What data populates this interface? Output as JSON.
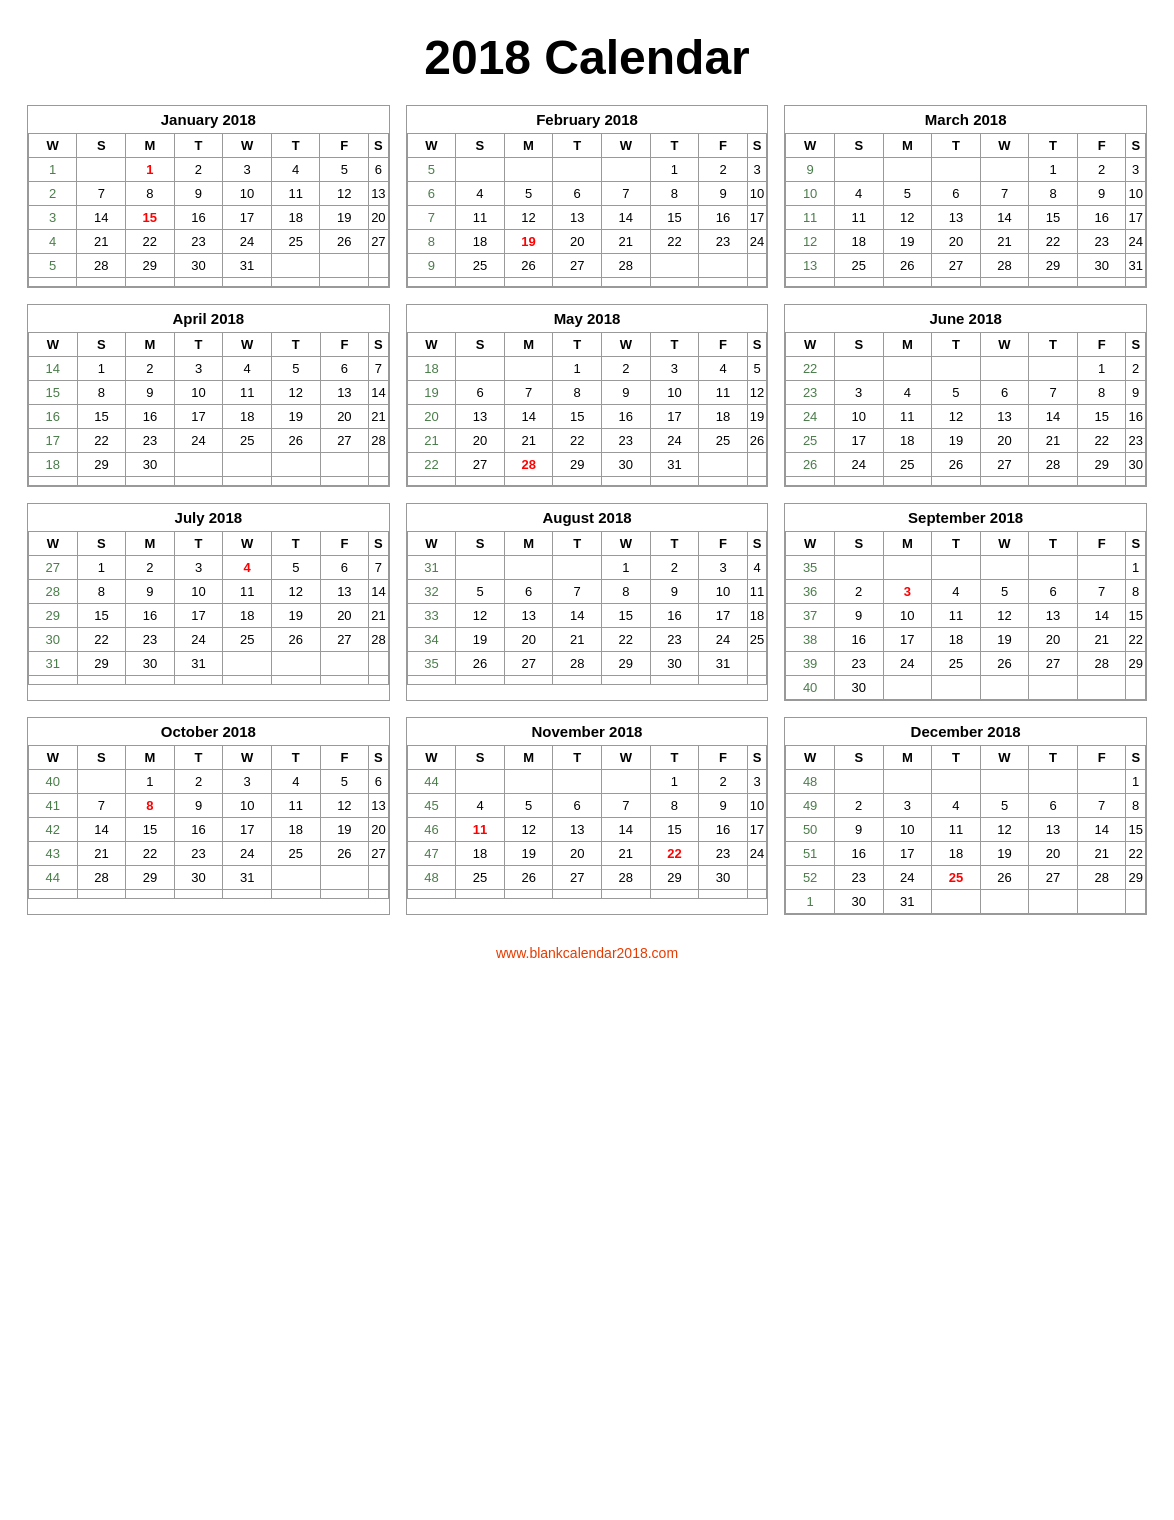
{
  "title": "2018 Calendar",
  "footer": "www.blankcalendar2018.com",
  "months": [
    {
      "name": "January 2018",
      "headers": [
        "W",
        "S",
        "M",
        "T",
        "W",
        "T",
        "F",
        "S"
      ],
      "rows": [
        [
          "1",
          "",
          "1",
          "2",
          "3",
          "4",
          "5",
          "6"
        ],
        [
          "2",
          "7",
          "8",
          "9",
          "10",
          "11",
          "12",
          "13"
        ],
        [
          "3",
          "14",
          "15",
          "16",
          "17",
          "18",
          "19",
          "20"
        ],
        [
          "4",
          "21",
          "22",
          "23",
          "24",
          "25",
          "26",
          "27"
        ],
        [
          "5",
          "28",
          "29",
          "30",
          "31",
          "",
          "",
          ""
        ]
      ],
      "redCells": [
        [
          "0",
          "2"
        ],
        [
          "1",
          "1"
        ]
      ],
      "greenCells": [
        [
          "2",
          "2"
        ]
      ]
    },
    {
      "name": "February 2018",
      "headers": [
        "W",
        "S",
        "M",
        "T",
        "W",
        "T",
        "F",
        "S"
      ],
      "rows": [
        [
          "5",
          "",
          "",
          "",
          "1",
          "2",
          "3"
        ],
        [
          "6",
          "4",
          "5",
          "6",
          "7",
          "8",
          "9",
          "10"
        ],
        [
          "7",
          "11",
          "12",
          "13",
          "14",
          "15",
          "16",
          "17"
        ],
        [
          "8",
          "18",
          "19",
          "20",
          "21",
          "22",
          "23",
          "24"
        ],
        [
          "9",
          "25",
          "26",
          "27",
          "28",
          "",
          "",
          ""
        ]
      ],
      "redCells": [
        [
          "1",
          "3"
        ],
        [
          "2",
          "3"
        ],
        [
          "0",
          "3"
        ],
        [
          "0",
          "4"
        ],
        [
          "0",
          "5"
        ]
      ],
      "greenCells": [
        [
          "1",
          "2"
        ]
      ]
    },
    {
      "name": "March 2018",
      "headers": [
        "W",
        "S",
        "M",
        "T",
        "W",
        "T",
        "F",
        "S"
      ],
      "rows": [
        [
          "9",
          "",
          "",
          "",
          "1",
          "2",
          "3"
        ],
        [
          "10",
          "4",
          "5",
          "6",
          "7",
          "8",
          "9",
          "10"
        ],
        [
          "11",
          "11",
          "12",
          "13",
          "14",
          "15",
          "16",
          "17"
        ],
        [
          "12",
          "18",
          "19",
          "20",
          "21",
          "22",
          "23",
          "24"
        ],
        [
          "13",
          "25",
          "26",
          "27",
          "28",
          "29",
          "30",
          "31"
        ]
      ],
      "redCells": [],
      "greenCells": []
    },
    {
      "name": "April 2018",
      "headers": [
        "W",
        "S",
        "M",
        "T",
        "W",
        "T",
        "F",
        "S"
      ],
      "rows": [
        [
          "14",
          "1",
          "2",
          "3",
          "4",
          "5",
          "6",
          "7"
        ],
        [
          "15",
          "8",
          "9",
          "10",
          "11",
          "12",
          "13",
          "14"
        ],
        [
          "16",
          "15",
          "16",
          "17",
          "18",
          "19",
          "20",
          "21"
        ],
        [
          "17",
          "22",
          "23",
          "24",
          "25",
          "26",
          "27",
          "28"
        ],
        [
          "18",
          "29",
          "30",
          "",
          "",
          "",
          "",
          ""
        ]
      ],
      "redCells": [],
      "greenCells": []
    },
    {
      "name": "May 2018",
      "headers": [
        "W",
        "S",
        "M",
        "T",
        "W",
        "T",
        "F",
        "S"
      ],
      "rows": [
        [
          "18",
          "",
          "1",
          "2",
          "3",
          "4",
          "5"
        ],
        [
          "19",
          "6",
          "7",
          "8",
          "9",
          "10",
          "11",
          "12"
        ],
        [
          "20",
          "13",
          "14",
          "15",
          "16",
          "17",
          "18",
          "19"
        ],
        [
          "21",
          "20",
          "21",
          "22",
          "23",
          "24",
          "25",
          "26"
        ],
        [
          "22",
          "27",
          "28",
          "29",
          "30",
          "31",
          "",
          ""
        ]
      ],
      "redCells": [
        [
          "4",
          "2"
        ]
      ],
      "greenCells": []
    },
    {
      "name": "June 2018",
      "headers": [
        "W",
        "S",
        "M",
        "T",
        "W",
        "T",
        "F",
        "S"
      ],
      "rows": [
        [
          "22",
          "",
          "",
          "",
          "",
          "",
          "1",
          "2"
        ],
        [
          "23",
          "3",
          "4",
          "5",
          "6",
          "7",
          "8",
          "9"
        ],
        [
          "24",
          "10",
          "11",
          "12",
          "13",
          "14",
          "15",
          "16"
        ],
        [
          "25",
          "17",
          "18",
          "19",
          "20",
          "21",
          "22",
          "23"
        ],
        [
          "26",
          "24",
          "25",
          "26",
          "27",
          "28",
          "29",
          "30"
        ]
      ],
      "redCells": [],
      "greenCells": []
    },
    {
      "name": "July 2018",
      "headers": [
        "W",
        "S",
        "M",
        "T",
        "W",
        "T",
        "F",
        "S"
      ],
      "rows": [
        [
          "27",
          "1",
          "2",
          "3",
          "4",
          "5",
          "6",
          "7"
        ],
        [
          "28",
          "8",
          "9",
          "10",
          "11",
          "12",
          "13",
          "14"
        ],
        [
          "29",
          "15",
          "16",
          "17",
          "18",
          "19",
          "20",
          "21"
        ],
        [
          "30",
          "22",
          "23",
          "24",
          "25",
          "26",
          "27",
          "28"
        ],
        [
          "31",
          "29",
          "30",
          "31",
          "",
          "",
          "",
          ""
        ]
      ],
      "redCells": [
        [
          "0",
          "4"
        ]
      ],
      "greenCells": []
    },
    {
      "name": "August 2018",
      "headers": [
        "W",
        "S",
        "M",
        "T",
        "W",
        "T",
        "F",
        "S"
      ],
      "rows": [
        [
          "31",
          "",
          "",
          "1",
          "2",
          "3",
          "4"
        ],
        [
          "32",
          "5",
          "6",
          "7",
          "8",
          "9",
          "10",
          "11"
        ],
        [
          "33",
          "12",
          "13",
          "14",
          "15",
          "16",
          "17",
          "18"
        ],
        [
          "34",
          "19",
          "20",
          "21",
          "22",
          "23",
          "24",
          "25"
        ],
        [
          "35",
          "26",
          "27",
          "28",
          "29",
          "30",
          "31",
          ""
        ]
      ],
      "redCells": [],
      "greenCells": []
    },
    {
      "name": "September 2018",
      "headers": [
        "W",
        "S",
        "M",
        "T",
        "W",
        "T",
        "F",
        "S"
      ],
      "rows": [
        [
          "35",
          "",
          "",
          "",
          "",
          "",
          "",
          "1"
        ],
        [
          "36",
          "2",
          "3",
          "4",
          "5",
          "6",
          "7",
          "8"
        ],
        [
          "37",
          "9",
          "10",
          "11",
          "12",
          "13",
          "14",
          "15"
        ],
        [
          "38",
          "16",
          "17",
          "18",
          "19",
          "20",
          "21",
          "22"
        ],
        [
          "39",
          "23",
          "24",
          "25",
          "26",
          "27",
          "28",
          "29"
        ],
        [
          "40",
          "30",
          "",
          "",
          "",
          "",
          "",
          ""
        ]
      ],
      "redCells": [
        [
          "1",
          "2"
        ]
      ],
      "greenCells": []
    },
    {
      "name": "October 2018",
      "headers": [
        "W",
        "S",
        "M",
        "T",
        "W",
        "T",
        "F",
        "S"
      ],
      "rows": [
        [
          "40",
          "",
          "1",
          "2",
          "3",
          "4",
          "5",
          "6"
        ],
        [
          "41",
          "7",
          "8",
          "9",
          "10",
          "11",
          "12",
          "13"
        ],
        [
          "42",
          "14",
          "15",
          "16",
          "17",
          "18",
          "19",
          "20"
        ],
        [
          "43",
          "21",
          "22",
          "23",
          "24",
          "25",
          "26",
          "27"
        ],
        [
          "44",
          "28",
          "29",
          "30",
          "31",
          "",
          "",
          ""
        ]
      ],
      "redCells": [
        [
          "1",
          "2"
        ]
      ],
      "greenCells": []
    },
    {
      "name": "November 2018",
      "headers": [
        "W",
        "S",
        "M",
        "T",
        "W",
        "T",
        "F",
        "S"
      ],
      "rows": [
        [
          "44",
          "",
          "",
          "",
          "1",
          "2",
          "3"
        ],
        [
          "45",
          "4",
          "5",
          "6",
          "7",
          "8",
          "9",
          "10"
        ],
        [
          "46",
          "11",
          "12",
          "13",
          "14",
          "15",
          "16",
          "17"
        ],
        [
          "47",
          "18",
          "19",
          "20",
          "21",
          "22",
          "23",
          "24"
        ],
        [
          "48",
          "25",
          "26",
          "27",
          "28",
          "29",
          "30",
          ""
        ]
      ],
      "redCells": [
        [
          "3",
          "5"
        ]
      ],
      "greenCells": [
        [
          "2",
          "1"
        ]
      ]
    },
    {
      "name": "December 2018",
      "headers": [
        "W",
        "S",
        "M",
        "T",
        "W",
        "T",
        "F",
        "S"
      ],
      "rows": [
        [
          "48",
          "",
          "",
          "",
          "",
          "",
          "",
          "1"
        ],
        [
          "49",
          "2",
          "3",
          "4",
          "5",
          "6",
          "7",
          "8"
        ],
        [
          "50",
          "9",
          "10",
          "11",
          "12",
          "13",
          "14",
          "15"
        ],
        [
          "51",
          "16",
          "17",
          "18",
          "19",
          "20",
          "21",
          "22"
        ],
        [
          "52",
          "23",
          "24",
          "25",
          "26",
          "27",
          "28",
          "29"
        ],
        [
          "1",
          "30",
          "31",
          "",
          "",
          "",
          "",
          ""
        ]
      ],
      "redCells": [
        [
          "4",
          "3"
        ]
      ],
      "greenCells": []
    }
  ]
}
